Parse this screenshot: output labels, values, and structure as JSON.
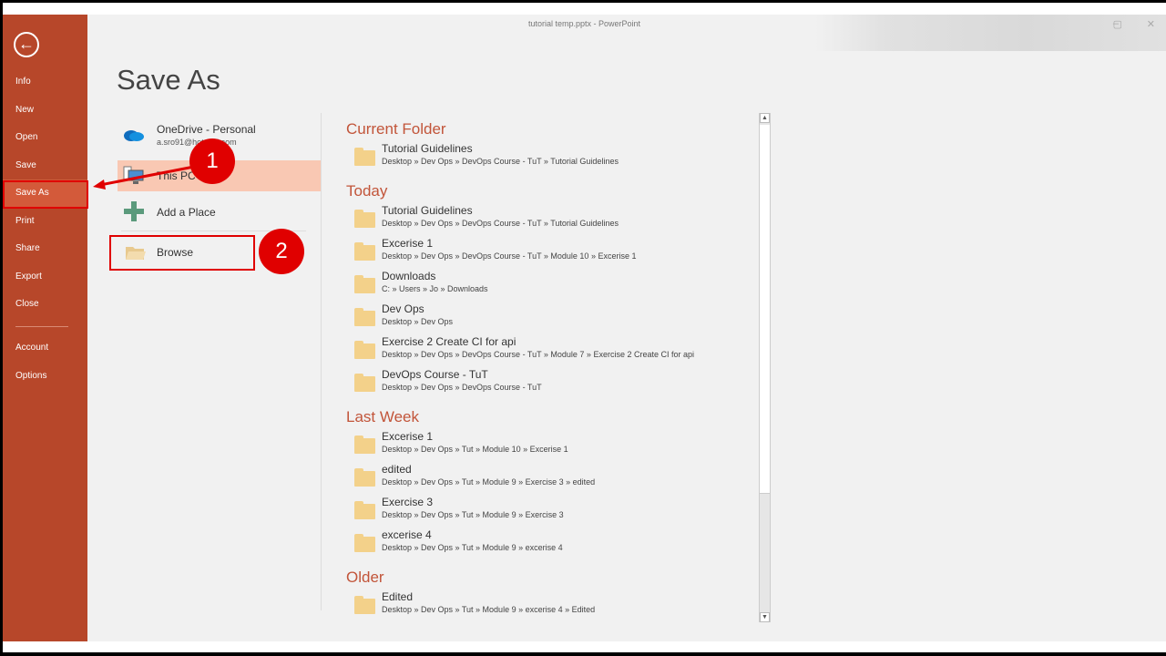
{
  "window": {
    "title": "tutorial temp.pptx - PowerPoint",
    "controls": [
      "–",
      "▢",
      "✕"
    ]
  },
  "sidebar": {
    "back_icon": "arrow-left-circle",
    "items": [
      {
        "label": "Info"
      },
      {
        "label": "New"
      },
      {
        "label": "Open"
      },
      {
        "label": "Save"
      },
      {
        "label": "Save As",
        "active": true
      },
      {
        "label": "Print"
      },
      {
        "label": "Share"
      },
      {
        "label": "Export"
      },
      {
        "label": "Close"
      }
    ],
    "bottom_items": [
      {
        "label": "Account"
      },
      {
        "label": "Options"
      }
    ],
    "accent": "#b7472a"
  },
  "page_title": "Save As",
  "locations": {
    "onedrive": {
      "label": "OneDrive - Personal",
      "account": "a.sro91@hotmail.com"
    },
    "this_pc": {
      "label": "This PC"
    },
    "add_place": {
      "label": "Add a Place"
    },
    "browse": {
      "label": "Browse"
    }
  },
  "annotations": {
    "step1": "1",
    "step2": "2",
    "color": "#e00000"
  },
  "folders": [
    {
      "heading": "Current Folder",
      "items": [
        {
          "name": "Tutorial Guidelines",
          "path": "Desktop » Dev Ops » DevOps Course - TuT » Tutorial Guidelines"
        }
      ]
    },
    {
      "heading": "Today",
      "items": [
        {
          "name": "Tutorial Guidelines",
          "path": "Desktop » Dev Ops » DevOps Course - TuT » Tutorial Guidelines"
        },
        {
          "name": "Excerise 1",
          "path": "Desktop » Dev Ops » DevOps Course - TuT » Module 10 » Excerise 1"
        },
        {
          "name": "Downloads",
          "path": "C: » Users » Jo » Downloads"
        },
        {
          "name": "Dev Ops",
          "path": "Desktop » Dev Ops"
        },
        {
          "name": "Exercise 2 Create CI for api",
          "path": "Desktop » Dev Ops » DevOps Course - TuT » Module 7 » Exercise 2 Create CI for api"
        },
        {
          "name": "DevOps Course - TuT",
          "path": "Desktop » Dev Ops » DevOps Course - TuT"
        }
      ]
    },
    {
      "heading": "Last Week",
      "items": [
        {
          "name": "Excerise 1",
          "path": "Desktop » Dev Ops » Tut » Module 10 » Excerise 1"
        },
        {
          "name": "edited",
          "path": "Desktop » Dev Ops » Tut » Module 9 » Exercise 3 » edited"
        },
        {
          "name": "Exercise 3",
          "path": "Desktop » Dev Ops » Tut » Module 9 » Exercise 3"
        },
        {
          "name": "excerise 4",
          "path": "Desktop » Dev Ops » Tut » Module 9 » excerise 4"
        }
      ]
    },
    {
      "heading": "Older",
      "items": [
        {
          "name": "Edited",
          "path": "Desktop » Dev Ops » Tut » Module 9 » excerise 4 » Edited"
        }
      ]
    }
  ]
}
